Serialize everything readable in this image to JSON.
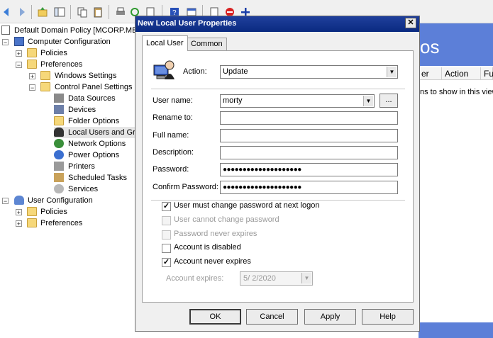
{
  "toolbar": {
    "icons": [
      "back-arrow",
      "forward-arrow",
      "up-folder",
      "show-hide-tree",
      "copy",
      "paste",
      "print",
      "refresh",
      "export",
      "help",
      "properties",
      "new-item",
      "delete",
      "add"
    ]
  },
  "tree": {
    "root": "Default Domain Policy [MCORP.MEG",
    "computer_config": "Computer Configuration",
    "policies": "Policies",
    "preferences": "Preferences",
    "windows_settings": "Windows Settings",
    "control_panel_settings": "Control Panel Settings",
    "data_sources": "Data Sources",
    "devices": "Devices",
    "folder_options": "Folder Options",
    "local_users": "Local Users and Gro",
    "network_options": "Network Options",
    "power_options": "Power Options",
    "printers": "Printers",
    "scheduled_tasks": "Scheduled Tasks",
    "services": "Services",
    "user_config": "User Configuration",
    "user_policies": "Policies",
    "user_preferences": "Preferences"
  },
  "right_pane": {
    "banner_text": "os",
    "columns": [
      "er",
      "Action",
      "Fu"
    ],
    "empty_text": "ns to show in this view"
  },
  "dialog": {
    "title": "New Local User Properties",
    "close_glyph": "✕",
    "tabs": [
      "Local User",
      "Common"
    ],
    "action_label": "Action:",
    "action_value": "Update",
    "username_label": "User name:",
    "username_value": "morty",
    "browse_label": "...",
    "rename_label": "Rename to:",
    "rename_value": "",
    "fullname_label": "Full name:",
    "fullname_value": "",
    "description_label": "Description:",
    "description_value": "",
    "password_label": "Password:",
    "password_value": "●●●●●●●●●●●●●●●●●●●●",
    "confirm_label": "Confirm Password:",
    "confirm_value": "●●●●●●●●●●●●●●●●●●●●",
    "checks": [
      {
        "label": "User must change password at next logon",
        "checked": true,
        "enabled": true
      },
      {
        "label": "User cannot change password",
        "checked": false,
        "enabled": false
      },
      {
        "label": "Password never expires",
        "checked": false,
        "enabled": false
      },
      {
        "label": "Account is disabled",
        "checked": false,
        "enabled": true
      },
      {
        "label": "Account never expires",
        "checked": true,
        "enabled": true
      }
    ],
    "expires_label": "Account expires:",
    "expires_value": "5/  2/2020",
    "buttons": {
      "ok": "OK",
      "cancel": "Cancel",
      "apply": "Apply",
      "help": "Help"
    }
  },
  "colors": {
    "titlebar": "#0a2a80",
    "banner": "#5c7fd8",
    "folder": "#f6d87a"
  }
}
